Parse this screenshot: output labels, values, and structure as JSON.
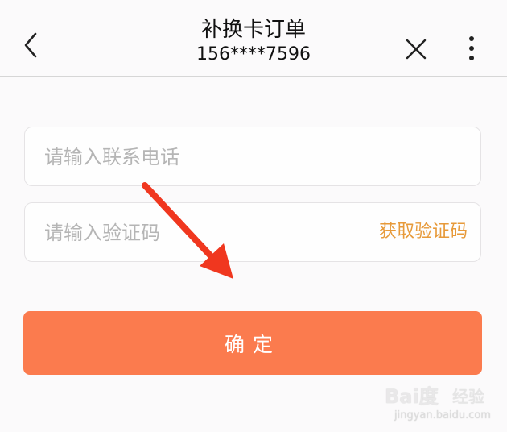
{
  "header": {
    "title": "补换卡订单",
    "subtitle": "156****7596",
    "back_icon": "chevron-left-icon",
    "close_icon": "close-icon",
    "more_icon": "more-vertical-icon"
  },
  "form": {
    "phone_placeholder": "请输入联系电话",
    "code_placeholder": "请输入验证码",
    "get_code_label": "获取验证码",
    "get_code_color": "#e79a3a"
  },
  "confirm": {
    "label": "确定",
    "color": "#fb7b4e"
  },
  "annotation": {
    "arrow_color": "#f0371f"
  },
  "watermark": {
    "logo": "Bai度",
    "jingyan": "经验",
    "url": "jingyan.baidu.com"
  }
}
